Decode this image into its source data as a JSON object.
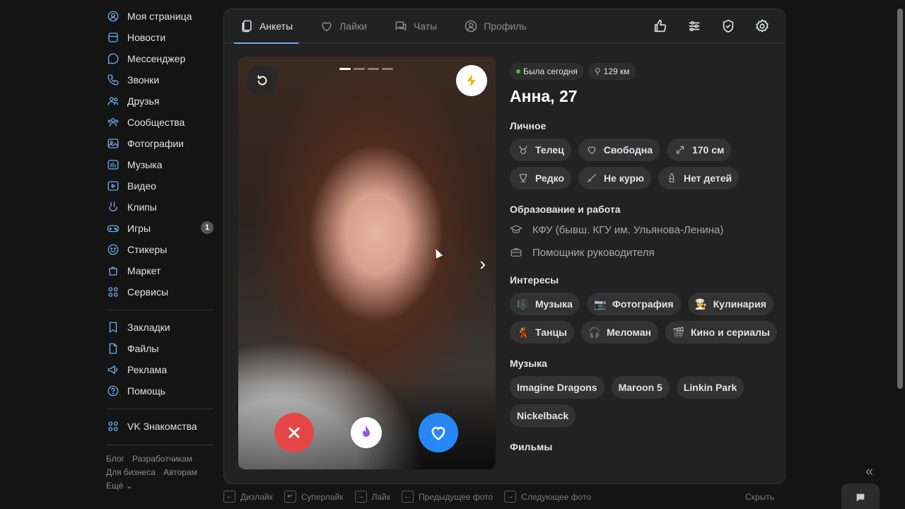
{
  "sidebar": {
    "items": [
      {
        "label": "Моя страница",
        "icon": "user-circle-icon"
      },
      {
        "label": "Новости",
        "icon": "news-icon"
      },
      {
        "label": "Мессенджер",
        "icon": "message-icon"
      },
      {
        "label": "Звонки",
        "icon": "phone-icon"
      },
      {
        "label": "Друзья",
        "icon": "friends-icon"
      },
      {
        "label": "Сообщества",
        "icon": "communities-icon"
      },
      {
        "label": "Фотографии",
        "icon": "photo-icon"
      },
      {
        "label": "Музыка",
        "icon": "music-icon"
      },
      {
        "label": "Видео",
        "icon": "video-icon"
      },
      {
        "label": "Клипы",
        "icon": "clips-icon"
      },
      {
        "label": "Игры",
        "icon": "gamepad-icon",
        "badge": "1"
      },
      {
        "label": "Стикеры",
        "icon": "sticker-icon"
      },
      {
        "label": "Маркет",
        "icon": "market-bag-icon"
      },
      {
        "label": "Сервисы",
        "icon": "services-grid-icon"
      }
    ],
    "items2": [
      {
        "label": "Закладки",
        "icon": "bookmark-icon"
      },
      {
        "label": "Файлы",
        "icon": "file-icon"
      },
      {
        "label": "Реклама",
        "icon": "megaphone-icon"
      },
      {
        "label": "Помощь",
        "icon": "help-icon"
      }
    ],
    "items3": [
      {
        "label": "VK Знакомства",
        "icon": "apps-grid-icon"
      }
    ],
    "footer": {
      "blog": "Блог",
      "developers": "Разработчикам",
      "business": "Для бизнеса",
      "authors": "Авторам",
      "more": "Ещё ⌄"
    }
  },
  "tabs": [
    {
      "label": "Анкеты",
      "active": true
    },
    {
      "label": "Лайки",
      "active": false
    },
    {
      "label": "Чаты",
      "active": false
    },
    {
      "label": "Профиль",
      "active": false
    }
  ],
  "profile": {
    "status": "Была сегодня",
    "distance": "129 км",
    "name": "Анна, 27",
    "sections": {
      "personal": "Личное",
      "education": "Образование и работа",
      "interests": "Интересы",
      "music": "Музыка",
      "films": "Фильмы"
    },
    "personal": [
      {
        "label": "Телец",
        "icon": "taurus-icon"
      },
      {
        "label": "Свободна",
        "icon": "heart-icon"
      },
      {
        "label": "170 см",
        "icon": "height-icon"
      },
      {
        "label": "Редко",
        "icon": "glass-icon"
      },
      {
        "label": "Не курю",
        "icon": "no-smoking-icon"
      },
      {
        "label": "Нет детей",
        "icon": "bottle-icon"
      }
    ],
    "education": "КФУ (бывш. КГУ им. Ульянова-Ленина)",
    "job": "Помощник руководителя",
    "interests": [
      {
        "label": "Музыка",
        "icon": "🎼"
      },
      {
        "label": "Фотография",
        "icon": "📷"
      },
      {
        "label": "Кулинария",
        "icon": "👩‍🍳"
      },
      {
        "label": "Танцы",
        "icon": "💃"
      },
      {
        "label": "Меломан",
        "icon": "🎧"
      },
      {
        "label": "Кино и сериалы",
        "icon": "🎬"
      }
    ],
    "music": [
      "Imagine Dragons",
      "Maroon 5",
      "Linkin Park",
      "Nickelback"
    ]
  },
  "hints": {
    "dislike": "Дизлайк",
    "superlike": "Суперлайк",
    "like": "Лайк",
    "prev": "Предыдущее фото",
    "next": "Следующее фото",
    "hide": "Скрыть"
  },
  "colors": {
    "accent": "#71aaeb",
    "dislike": "#e64646",
    "like": "#2787f5",
    "online": "#4bb34b"
  }
}
